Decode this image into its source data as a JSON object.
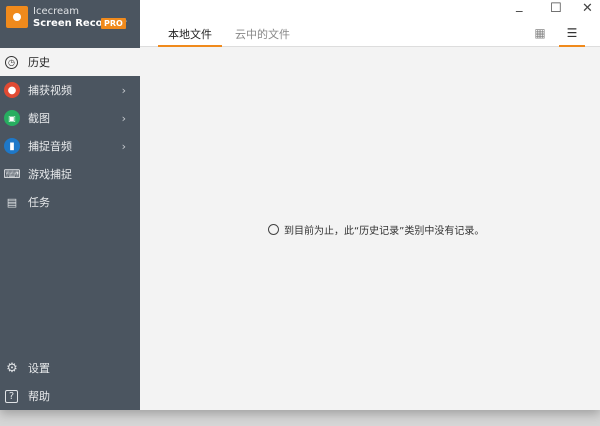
{
  "app": {
    "brand_line1": "Icecream",
    "brand_line2": "Screen Recorder",
    "badge": "PRO"
  },
  "sidebar": {
    "items": [
      {
        "label": "历史",
        "icon": "clock-icon"
      },
      {
        "label": "捕获视频",
        "icon": "record-icon"
      },
      {
        "label": "截图",
        "icon": "camera-icon"
      },
      {
        "label": "捕捉音频",
        "icon": "microphone-icon"
      },
      {
        "label": "游戏捕捉",
        "icon": "gamepad-icon"
      },
      {
        "label": "任务",
        "icon": "task-icon"
      }
    ],
    "bottom": [
      {
        "label": "设置",
        "icon": "gear-icon"
      },
      {
        "label": "帮助",
        "icon": "help-icon"
      }
    ]
  },
  "tabs": [
    {
      "label": "本地文件"
    },
    {
      "label": "云中的文件"
    }
  ],
  "empty_message": "到目前为止，此“历史记录”类别中没有记录。",
  "colors": {
    "accent": "#f08a1c",
    "sidebar": "#4b5560",
    "record": "#e04a33",
    "camera": "#27ae60",
    "mic": "#1e78c8"
  }
}
